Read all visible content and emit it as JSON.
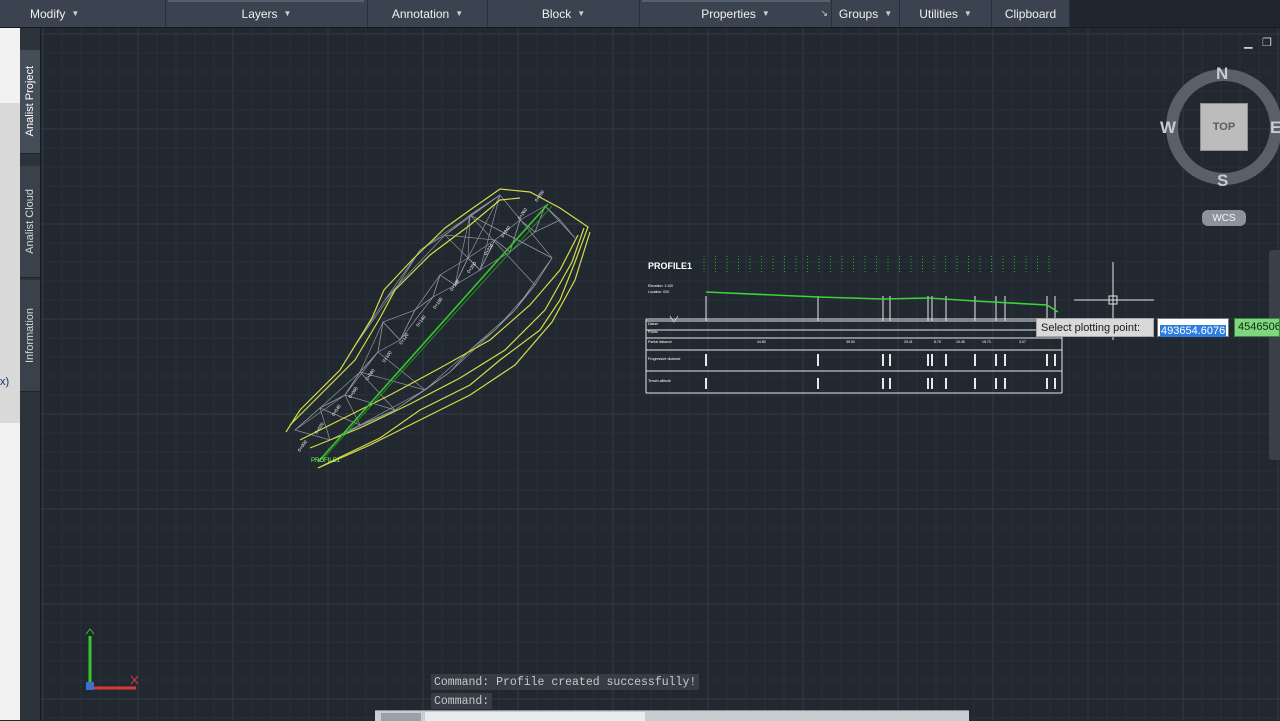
{
  "ribbon": {
    "panels": [
      {
        "label": "Modify"
      },
      {
        "label": "Layers"
      },
      {
        "label": "Annotation"
      },
      {
        "label": "Block"
      },
      {
        "label": "Properties"
      },
      {
        "label": "Groups"
      },
      {
        "label": "Utilities"
      },
      {
        "label": "Clipboard"
      }
    ]
  },
  "palette": {
    "tabs": [
      {
        "label": "Analist Project",
        "active": true
      },
      {
        "label": "Analist Cloud",
        "active": false
      },
      {
        "label": "Information",
        "active": false
      }
    ],
    "left_fragment": "x)"
  },
  "viewport": {
    "minimize_glyph": "▁",
    "restore_glyph": "❐"
  },
  "viewcube": {
    "face": "TOP",
    "north": "N",
    "south": "S",
    "east": "E",
    "west": "W",
    "wcs_label": "WCS"
  },
  "profile": {
    "title": "PROFILE1",
    "scale_lines": [
      "Elevation: 1:100",
      "Location: 000"
    ],
    "rows": [
      "Datum",
      "Points",
      "Partial distance",
      "Progressive distance",
      "Terrain altitude"
    ],
    "partial_values": [
      "44.80",
      "39.00",
      "29.41",
      "8.75",
      "10.45",
      "15.73",
      "3.07"
    ]
  },
  "survey_labels": [
    "0+000",
    "0+020",
    "0+040",
    "0+060",
    "0+080",
    "0+100",
    "0+120",
    "0+140",
    "0+160",
    "0+180",
    "0+200",
    "0+220",
    "0+240",
    "0+260",
    "0+280"
  ],
  "start_label": "PROFILE1",
  "dynamic_input": {
    "prompt": "Select plotting point:",
    "x_value": "493654.6076",
    "y_value": "4546506."
  },
  "command": {
    "history": [
      "Command: Profile created successfully!",
      "Command:"
    ]
  },
  "colors": {
    "background": "#212830",
    "grid": "#2c3440",
    "boundary": "#d7e04b",
    "centerline": "#39c62d",
    "mesh": "#9aa0a6",
    "profile_line": "#3fd23a"
  },
  "icons": {
    "ucs": "ucs-axis-icon",
    "crosshair": "crosshair-cursor-icon"
  }
}
